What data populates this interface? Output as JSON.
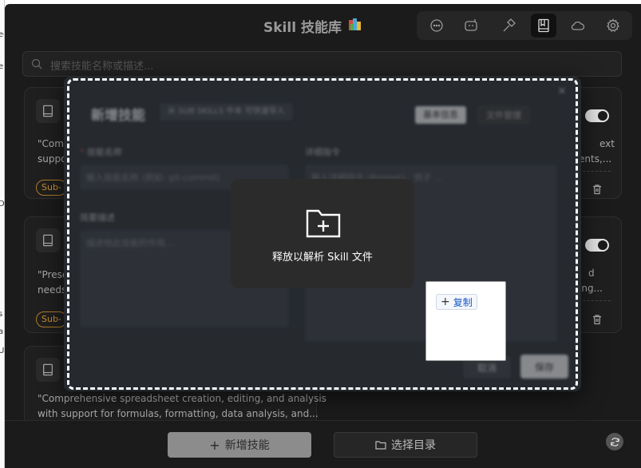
{
  "left_strip": {
    "chars": [
      "ec",
      "e",
      "D",
      "s",
      "a",
      "U"
    ]
  },
  "header": {
    "title": "Skill 技能库",
    "toolbar": [
      "chat-icon",
      "robot-icon",
      "hammer-icon",
      "book-icon",
      "cloud-icon",
      "gear-icon"
    ],
    "active_tool": "book-icon"
  },
  "search": {
    "placeholder": "搜索技能名称或描述..."
  },
  "cards": [
    {
      "desc_lines": [
        "\"Comp",
        "suppo"
      ],
      "tag": "Sub-",
      "right_lines": [
        "ext",
        "ents,..."
      ]
    },
    {
      "desc_lines": [
        "\"Prese",
        "needs"
      ],
      "tag": "Sub-",
      "right_lines": [
        "d",
        "ing..."
      ]
    },
    {
      "desc_lines": [
        "\"Comprehensive spreadsheet creation, editing, and analysis",
        "with support for formulas, formatting, data analysis, and..."
      ]
    }
  ],
  "bottom": {
    "add_label": "新增技能",
    "dir_label": "选择目录"
  },
  "modal": {
    "title": "新增技能",
    "hint": "从 SUB SKILLS 中本 可快速导入",
    "tabs": [
      "基本信息",
      "文件管理"
    ],
    "close": "×",
    "name_label": "技能名称",
    "required_mark": "*",
    "name_placeholder": "输入技能名称 (例如: git-commit)",
    "desc_label": "简要描述",
    "desc_placeholder": "描述他此技能的作用...",
    "detail_label": "详细指令",
    "detail_placeholder": "输入详细指令 (Prompt)，例子 ...",
    "cancel": "取消",
    "save": "保存"
  },
  "drop_overlay": {
    "text": "释放以解析 Skill 文件"
  },
  "context_popup": {
    "copy_label": "复制"
  },
  "colors": {
    "bg": "#1b1b1b",
    "card": "#1f1f1f",
    "tag": "#c8902f",
    "link": "#1a56c4"
  }
}
